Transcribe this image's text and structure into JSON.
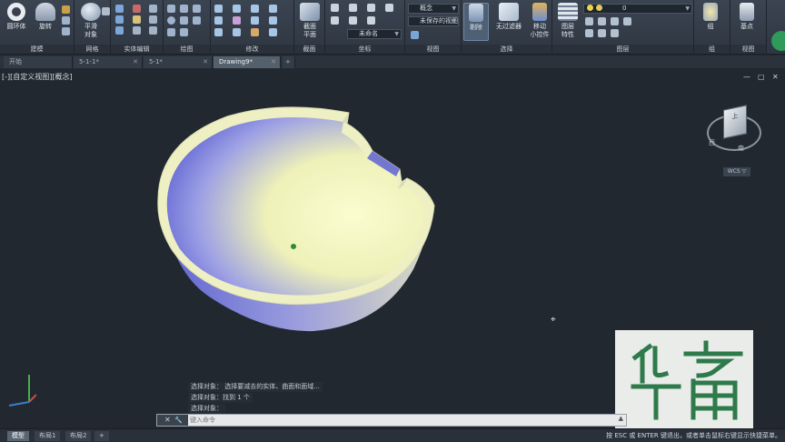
{
  "ribbon": {
    "modeling": {
      "torus_label": "圆环体",
      "revolve_label": "旋转",
      "panel": "建模"
    },
    "mesh": {
      "smooth_label": "平滑\n对象",
      "panel": "网格"
    },
    "solid_edit": {
      "panel": "实体编辑"
    },
    "draw": {
      "panel": "绘图"
    },
    "modify": {
      "panel": "修改"
    },
    "section": {
      "section_plane_label": "截面\n平面",
      "panel": "截面"
    },
    "coordinates": {
      "ucs_name": "未命名",
      "panel": "坐标"
    },
    "view": {
      "visual_style": "概念",
      "saved_view": "未保存的视图",
      "panel": "视图"
    },
    "selection": {
      "cull_label": "剔除",
      "no_filter_label": "无过滤器",
      "panel": "选择"
    },
    "gizmo": {
      "label": "移动\n小控件"
    },
    "layers": {
      "layer_properties_label": "图层\n特性",
      "layer_current": "0",
      "panel": "图层"
    },
    "groups": {
      "group_label": "组",
      "panel": "组"
    },
    "views2": {
      "base_label": "基点",
      "panel": "视图"
    }
  },
  "tabs": [
    {
      "label": "开始",
      "active": false
    },
    {
      "label": "5-1-1*",
      "active": false
    },
    {
      "label": "5-1*",
      "active": false
    },
    {
      "label": "Drawing9*",
      "active": true
    }
  ],
  "viewport": {
    "view_label": "[-][自定义视图][概念]",
    "viewcube_labels": {
      "top": "上",
      "west": "西",
      "south": "南"
    },
    "wcs_label": "WCS ▽",
    "cursor_glyph": "⌖"
  },
  "command": {
    "history": [
      "选择对象：  选择要减去的实体、曲面和面域...",
      "选择对象：找到 1 个",
      "选择对象："
    ],
    "placeholder": "键入命令",
    "close_icon": "✕",
    "tool_icon": "🔧"
  },
  "layout_tabs": [
    {
      "label": "模型",
      "active": true
    },
    {
      "label": "布局1",
      "active": false
    },
    {
      "label": "布局2",
      "active": false
    },
    {
      "label": "+",
      "active": false
    }
  ],
  "status": {
    "message": "按 ESC 或 ENTER 键退出，或者单击鼠标右键显示快捷菜单。"
  },
  "watermark": {
    "text": "华育",
    "color": "#2e7a4a"
  },
  "colors": {
    "ribbon_bg": "#343c47",
    "viewport_bg": "#212830",
    "bowl_inner_light": "#f4f6c0",
    "bowl_outer": "#6a6fd8",
    "accent": "#3a7dcc"
  }
}
